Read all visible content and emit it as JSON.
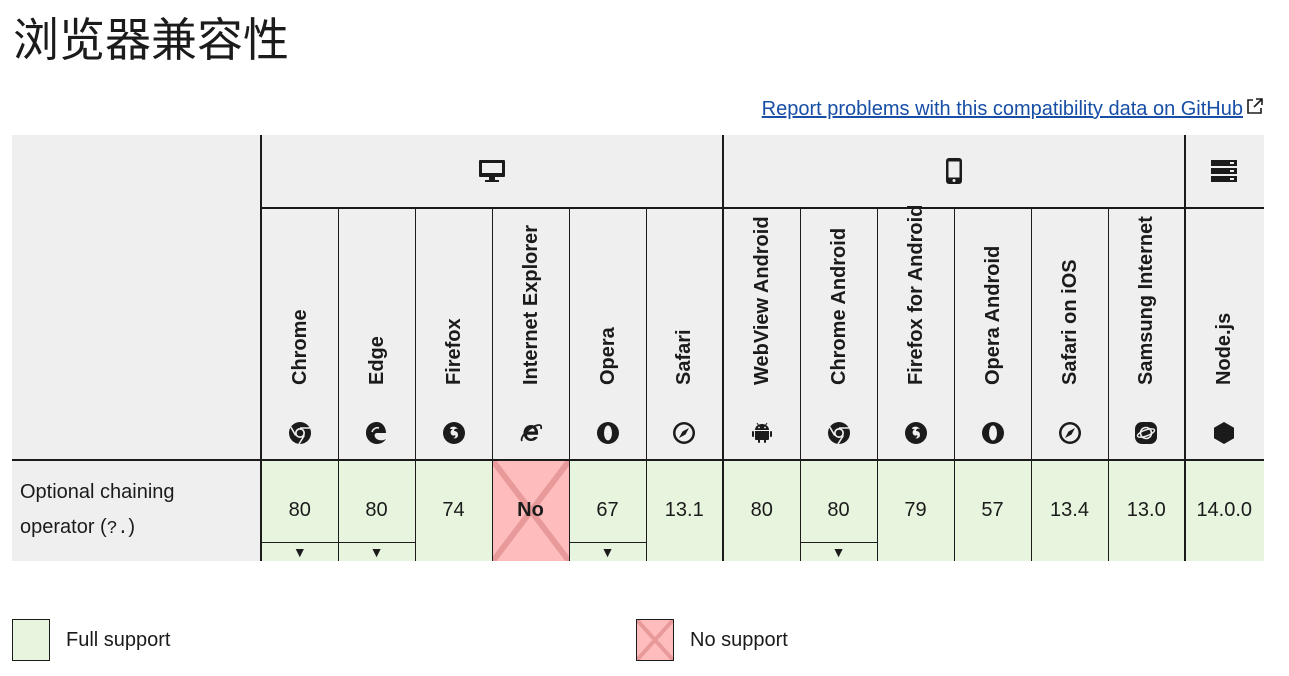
{
  "page": {
    "title": "浏览器兼容性"
  },
  "report_link": "Report problems with this compatibility data on GitHub",
  "platforms": [
    {
      "name": "desktop-icon"
    },
    {
      "name": "mobile-icon"
    },
    {
      "name": "server-icon"
    }
  ],
  "browsers": [
    {
      "name": "Chrome",
      "icon": "chrome-icon"
    },
    {
      "name": "Edge",
      "icon": "edge-icon"
    },
    {
      "name": "Firefox",
      "icon": "firefox-icon"
    },
    {
      "name": "Internet Explorer",
      "icon": "ie-icon"
    },
    {
      "name": "Opera",
      "icon": "opera-icon"
    },
    {
      "name": "Safari",
      "icon": "safari-icon"
    },
    {
      "name": "WebView Android",
      "icon": "android-icon"
    },
    {
      "name": "Chrome Android",
      "icon": "chrome-icon"
    },
    {
      "name": "Firefox for Android",
      "icon": "firefox-icon"
    },
    {
      "name": "Opera Android",
      "icon": "opera-icon"
    },
    {
      "name": "Safari on iOS",
      "icon": "safari-icon"
    },
    {
      "name": "Samsung Internet",
      "icon": "samsung-icon"
    },
    {
      "name": "Node.js",
      "icon": "nodejs-icon"
    }
  ],
  "feature": {
    "label_prefix": "Optional chaining",
    "label_mid": "operator (",
    "code": "?.",
    "label_suffix": ")"
  },
  "support": [
    {
      "value": "80",
      "status": "full",
      "toggle": "▼"
    },
    {
      "value": "80",
      "status": "full",
      "toggle": "▼"
    },
    {
      "value": "74",
      "status": "full",
      "toggle": ""
    },
    {
      "value": "No",
      "status": "none",
      "toggle": ""
    },
    {
      "value": "67",
      "status": "full",
      "toggle": "▼"
    },
    {
      "value": "13.1",
      "status": "full",
      "toggle": ""
    },
    {
      "value": "80",
      "status": "full",
      "toggle": ""
    },
    {
      "value": "80",
      "status": "full",
      "toggle": "▼"
    },
    {
      "value": "79",
      "status": "full",
      "toggle": ""
    },
    {
      "value": "57",
      "status": "full",
      "toggle": ""
    },
    {
      "value": "13.4",
      "status": "full",
      "toggle": ""
    },
    {
      "value": "13.0",
      "status": "full",
      "toggle": ""
    },
    {
      "value": "14.0.0",
      "status": "full",
      "toggle": ""
    }
  ],
  "legend": {
    "full": "Full support",
    "none": "No support"
  },
  "colors": {
    "full": "#e7f5de",
    "none": "#ffbcbc",
    "link": "#174ea6"
  }
}
